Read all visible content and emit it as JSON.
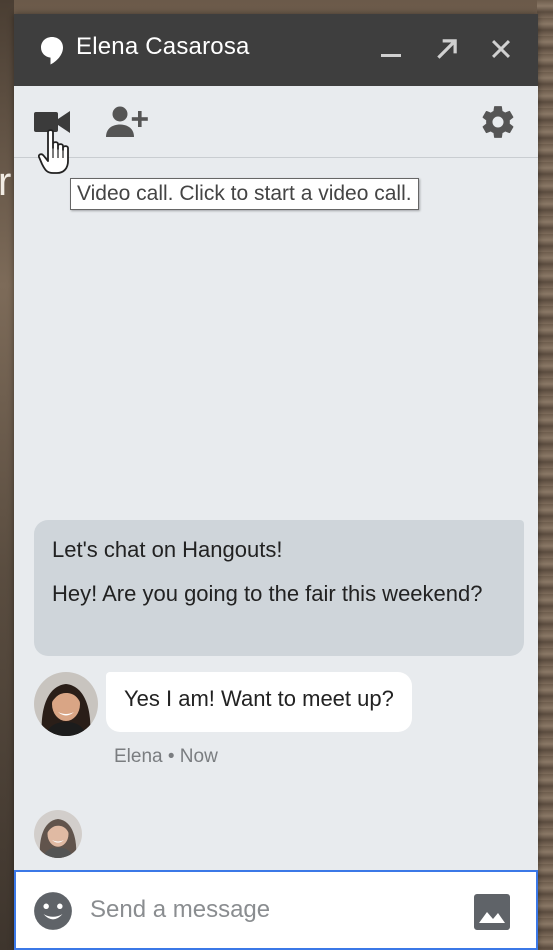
{
  "background": {
    "partial_letter": "r"
  },
  "window": {
    "title": "Elena Casarosa",
    "title_icon": "hangouts-bubble-icon",
    "controls": [
      "minimize-icon",
      "popout-icon",
      "close-icon"
    ]
  },
  "toolbar": {
    "buttons": [
      "video-camera-icon",
      "add-person-icon",
      "gear-icon"
    ]
  },
  "tooltip": {
    "text": "Video call. Click to start a video call."
  },
  "messages": {
    "incoming": {
      "line1": "Let's chat on Hangouts!",
      "line2": "Hey! Are you going to the fair this weekend?"
    },
    "reply": {
      "text": "Yes I am! Want to meet up?",
      "meta": "Elena • Now"
    }
  },
  "composer": {
    "placeholder": "Send a message",
    "value": ""
  },
  "colors": {
    "titlebar": "#3e3e3e",
    "panel": "#e8ebee",
    "incoming_bubble": "#cfd5da",
    "outgoing_bubble": "#ffffff",
    "focus_border": "#3b78e7",
    "icon": "#555555"
  }
}
